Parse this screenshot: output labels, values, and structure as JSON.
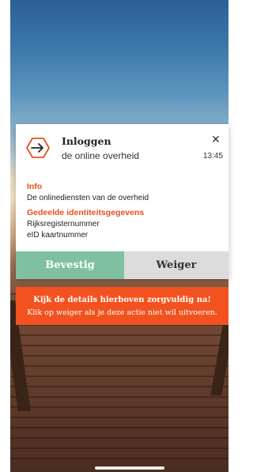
{
  "notification": {
    "title": "Inloggen",
    "subtitle": "de online overheid",
    "time": "13:45",
    "close_icon": "close-icon",
    "app_icon": "login-arrow-icon",
    "accent_color": "#e8501e"
  },
  "info": {
    "label": "Info",
    "text": "De onlinediensten van de overheid"
  },
  "shared": {
    "label": "Gedeelde identiteitsgegevens",
    "items": [
      "Rijksregisternummer",
      "eID kaartnummer"
    ]
  },
  "actions": {
    "confirm_label": "Bevestig",
    "confirm_color": "#7fc0a2",
    "reject_label": "Weiger",
    "reject_color": "#dcdcdc"
  },
  "warning": {
    "title": "Kijk de details hierboven zorgvuldig na!",
    "text": "Klik op weiger als je deze actie niet wil uitvoeren.",
    "color": "#f2521f"
  }
}
